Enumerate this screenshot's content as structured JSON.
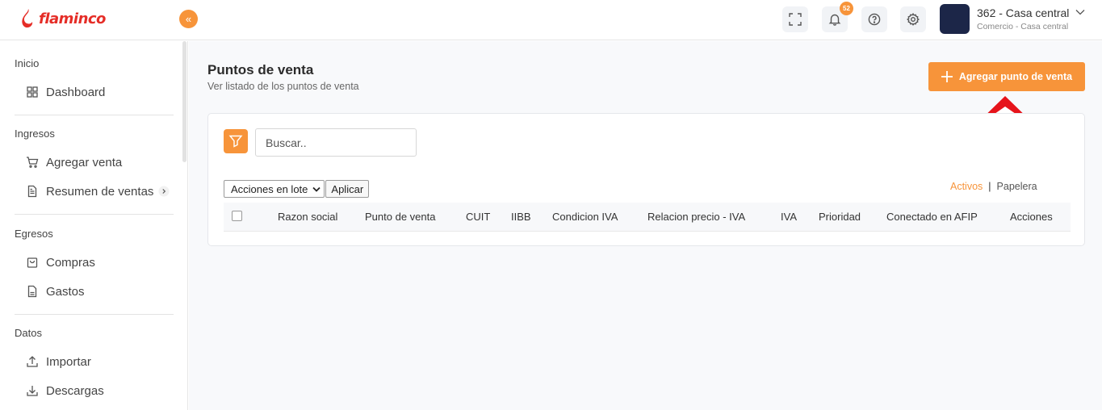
{
  "brand": {
    "name": "flaminco",
    "color": "#e52d27",
    "accent": "#f7943a"
  },
  "topbar": {
    "collapse_label": "«",
    "notifications_count": "52",
    "account": {
      "name": "362 - Casa central",
      "subtitle": "Comercio - Casa central"
    },
    "icons": [
      "fullscreen-icon",
      "bell-icon",
      "help-icon",
      "gear-icon",
      "chevron-down-icon"
    ]
  },
  "sidebar": {
    "sections": [
      {
        "title": "Inicio",
        "items": [
          {
            "label": "Dashboard",
            "icon": "grid-icon"
          }
        ]
      },
      {
        "title": "Ingresos",
        "items": [
          {
            "label": "Agregar venta",
            "icon": "cart-icon"
          },
          {
            "label": "Resumen de ventas",
            "icon": "document-icon"
          }
        ]
      },
      {
        "title": "Egresos",
        "items": [
          {
            "label": "Compras",
            "icon": "bag-icon"
          },
          {
            "label": "Gastos",
            "icon": "file-icon"
          }
        ]
      },
      {
        "title": "Datos",
        "items": [
          {
            "label": "Importar",
            "icon": "upload-icon"
          },
          {
            "label": "Descargas",
            "icon": "download-icon"
          }
        ]
      }
    ]
  },
  "main": {
    "title": "Puntos de venta",
    "subtitle": "Ver listado de los puntos de venta",
    "add_button": "Agregar punto de venta",
    "search_placeholder": "Buscar..",
    "bulk_select": "Acciones en lote",
    "apply_button": "Aplicar",
    "view_active": "Activos",
    "view_separator": "|",
    "view_trash": "Papelera",
    "columns": [
      "Razon social",
      "Punto de venta",
      "CUIT",
      "IIBB",
      "Condicion IVA",
      "Relacion precio - IVA",
      "IVA",
      "Prioridad",
      "Conectado en AFIP",
      "Acciones"
    ]
  }
}
